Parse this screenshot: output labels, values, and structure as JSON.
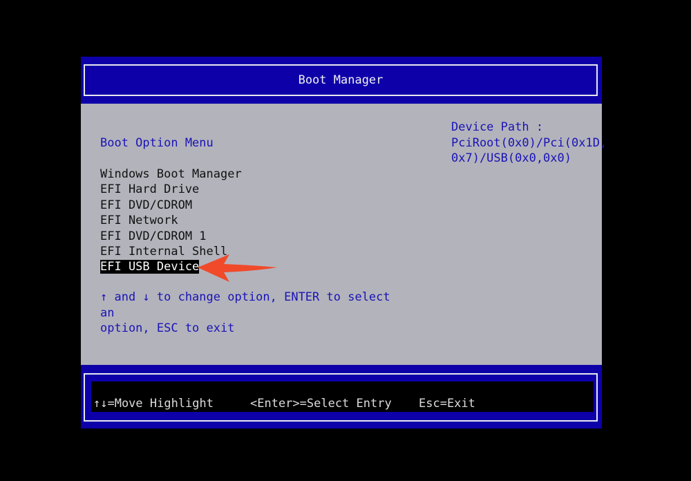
{
  "window": {
    "title": "Boot Manager"
  },
  "menu": {
    "heading": "Boot Option Menu",
    "items": [
      {
        "label": "Windows Boot Manager",
        "selected": false
      },
      {
        "label": "EFI Hard Drive",
        "selected": false
      },
      {
        "label": "EFI DVD/CDROM",
        "selected": false
      },
      {
        "label": "EFI Network",
        "selected": false
      },
      {
        "label": "EFI DVD/CDROM 1",
        "selected": false
      },
      {
        "label": "EFI Internal Shell",
        "selected": false
      },
      {
        "label": "EFI USB Device",
        "selected": true
      }
    ],
    "help_line1": "↑ and ↓ to change option, ENTER to select an",
    "help_line2": "option, ESC to exit"
  },
  "device_path": {
    "label": "Device Path :",
    "line1": "PciRoot(0x0)/Pci(0x1D,",
    "line2": "0x7)/USB(0x0,0x0)"
  },
  "footer": {
    "move": "↑↓=Move Highlight",
    "select": "<Enter>=Select Entry",
    "exit": "Esc=Exit"
  },
  "colors": {
    "header_blue": "#0d00a8",
    "panel_gray": "#b3b3bc",
    "text_blue": "#1a14b4",
    "annotation_arrow": "#f04a2a"
  },
  "icons": {
    "annotation": "red-arrow-pointer-icon"
  }
}
